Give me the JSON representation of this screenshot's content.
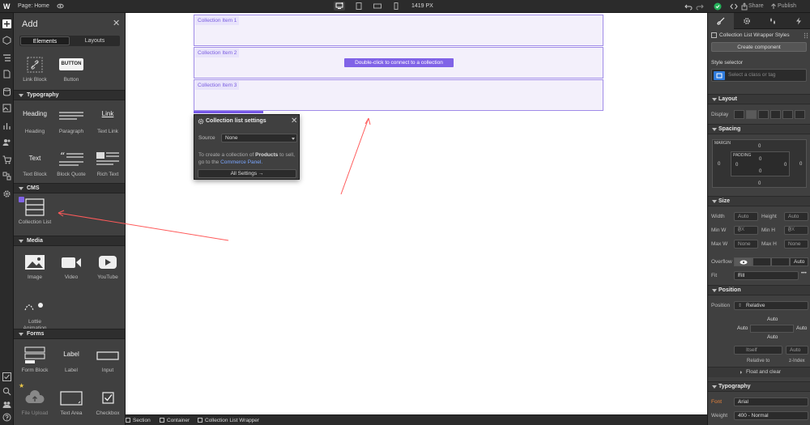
{
  "topbar": {
    "logo": "W",
    "page_label": "Page: Home",
    "width_px": "1419 PX",
    "share": "Share",
    "publish": "Publish"
  },
  "add_panel": {
    "title": "Add",
    "tabs": [
      "Elements",
      "Layouts"
    ],
    "link_block": "Link Block",
    "button": "Button",
    "button_preview": "BUTTON",
    "sections": {
      "typography": "Typography",
      "cms": "CMS",
      "media": "Media",
      "forms": "Forms"
    },
    "typography": {
      "heading_preview": "Heading",
      "heading": "Heading",
      "paragraph": "Paragraph",
      "text_link_preview": "Link",
      "text_link": "Text Link",
      "text_block_preview": "Text",
      "text_block": "Text Block",
      "block_quote": "Block Quote",
      "rich_text": "Rich Text"
    },
    "cms": {
      "collection_list": "Collection List"
    },
    "media": {
      "image": "Image",
      "video": "Video",
      "youtube": "YouTube",
      "lottie_line1": "Lottie",
      "lottie_line2": "Animation"
    },
    "forms": {
      "form_block": "Form Block",
      "label_preview": "Label",
      "label": "Label",
      "input": "Input",
      "file_upload": "File Upload",
      "text_area": "Text Area",
      "checkbox": "Checkbox"
    }
  },
  "canvas": {
    "items": [
      "Collection Item 1",
      "Collection Item 2",
      "Collection Item 3"
    ],
    "connect_button": "Double-click to connect to a collection"
  },
  "popup": {
    "title": "Collection list settings",
    "source_label": "Source",
    "source_value": "None",
    "text_pre": "To create a collection of ",
    "text_bold": "Products",
    "text_mid": " to sell, go to the ",
    "text_link": "Commerce Panel.",
    "all_settings": "All Settings"
  },
  "breadcrumbs": [
    "Section",
    "Container",
    "Collection List Wrapper"
  ],
  "right_panel": {
    "element_name": "Collection List Wrapper Styles",
    "create_component": "Create component",
    "style_selector": "Style selector",
    "class_placeholder": "Select a class or tag",
    "sections": {
      "layout": "Layout",
      "spacing": "Spacing",
      "size": "Size",
      "position": "Position",
      "typography": "Typography"
    },
    "display_label": "Display",
    "spacing": {
      "margin": "MARGIN",
      "padding": "PADDING",
      "values": [
        "0",
        "0",
        "0",
        "0",
        "0",
        "0",
        "0",
        "0"
      ]
    },
    "size": {
      "width": "Width",
      "width_val": "Auto",
      "height": "Height",
      "height_val": "Auto",
      "min_w": "Min W",
      "min_w_val": "0",
      "min_w_unit": "PX",
      "min_h": "Min H",
      "min_h_val": "0",
      "min_h_unit": "PX",
      "max_w": "Max W",
      "max_w_val": "None",
      "max_h": "Max H",
      "max_h_val": "None",
      "overflow": "Overflow",
      "overflow_auto": "Auto",
      "fit": "Fit",
      "fit_val": "Fill"
    },
    "position": {
      "label": "Position",
      "value": "Relative",
      "top": "Auto",
      "left": "Auto",
      "right": "Auto",
      "bottom": "Auto",
      "itself": "Itself",
      "z_auto": "Auto",
      "relative_to": "Relative to",
      "z_index": "z-Index",
      "float_clear": "Float and clear"
    },
    "typography": {
      "font": "Font",
      "font_val": "Arial",
      "weight": "Weight",
      "weight_val": "400 - Normal"
    }
  },
  "colors": {
    "accent": "#8063e7",
    "link_blue": "#7aa6ff",
    "annotation_arrow": "#ff5a5a"
  }
}
